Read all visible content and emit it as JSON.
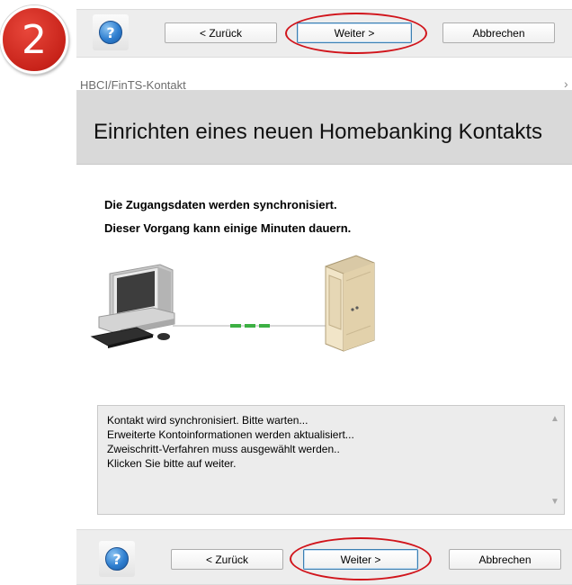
{
  "step_badge": {
    "number": "2"
  },
  "top_bar": {
    "help_icon": "help-icon",
    "back_label": "< Zurück",
    "next_label": "Weiter >",
    "cancel_label": "Abbrechen"
  },
  "dialog": {
    "window_title": "HBCI/FinTS-Kontakt",
    "header_title": "Einrichten eines neuen Homebanking Kontakts",
    "info_line_1": "Die Zugangsdaten werden synchronisiert.",
    "info_line_2": "Dieser Vorgang kann einige Minuten dauern.",
    "illustration": {
      "left": "computer-icon",
      "right": "server-icon",
      "connection": "progress-dashes"
    },
    "log_lines": [
      "Kontakt wird synchronisiert. Bitte warten...",
      "Erweiterte Kontoinformationen werden aktualisiert...",
      "Zweischritt-Verfahren muss ausgewählt werden..",
      "Klicken Sie bitte auf weiter."
    ]
  },
  "bottom_bar": {
    "help_icon": "help-icon",
    "back_label": "< Zurück",
    "next_label": "Weiter >",
    "cancel_label": "Abbrechen"
  },
  "colors": {
    "highlight_oval": "#d1141b",
    "badge": "#c8231a",
    "header_band": "#d9d9d9",
    "progress_dashes": "#3cb043"
  }
}
